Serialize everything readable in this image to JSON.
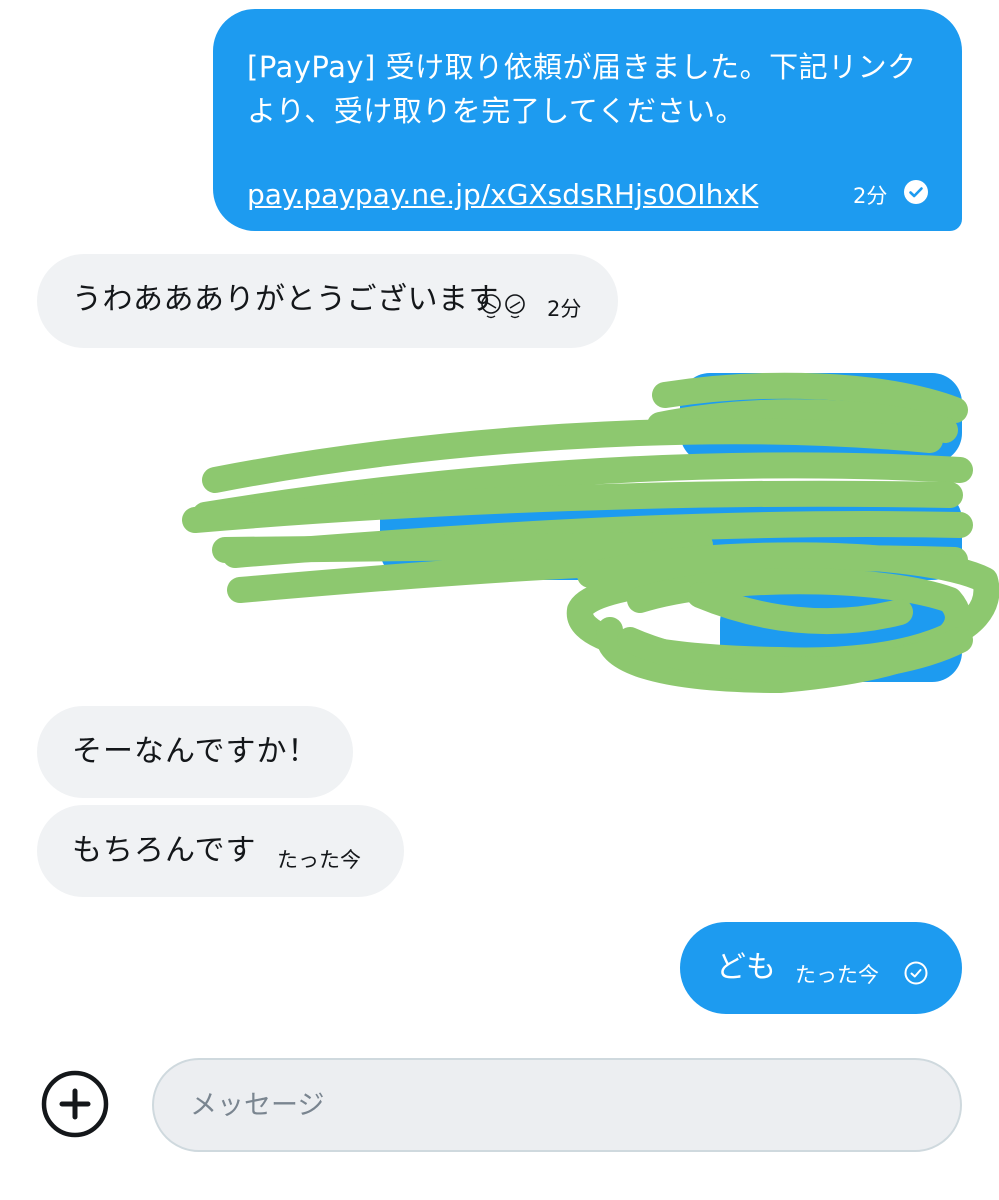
{
  "conversation": {
    "messages": [
      {
        "direction": "outgoing",
        "text": "[PayPay] 受け取り依頼が届きました。下記リンクより、受け取りを完了してください。",
        "link": "pay.paypay.ne.jp/xGXsdsRHjs0OIhxK",
        "time": "2分",
        "status_icon": "check-circle-filled-icon"
      },
      {
        "direction": "incoming",
        "text": "うわああありがとうございます",
        "emoji_icon": "smiling-face-emoji-icon",
        "time": "2分"
      },
      {
        "direction": "outgoing",
        "redacted": true,
        "redaction_note": "covered by green scribble"
      },
      {
        "direction": "incoming",
        "text": "そーなんですか！"
      },
      {
        "direction": "incoming",
        "text": "もちろんです",
        "time": "たった今"
      },
      {
        "direction": "outgoing",
        "text": "ども",
        "time": "たった今",
        "status_icon": "check-circle-outline-icon"
      }
    ]
  },
  "composer": {
    "placeholder": "メッセージ",
    "value": "",
    "add_icon": "plus-circle-icon"
  },
  "colors": {
    "outgoing_bubble": "#1d9bf0",
    "incoming_bubble": "#f0f2f4",
    "redaction_scribble": "#8dc86f",
    "composer_background": "#eceef1"
  }
}
